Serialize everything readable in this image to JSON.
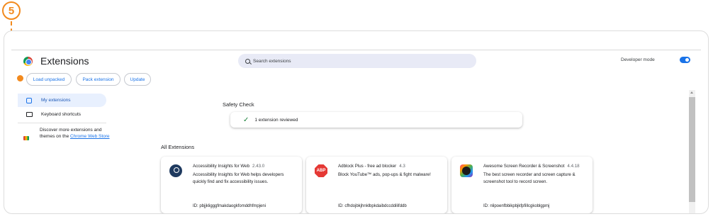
{
  "step_badge": "5",
  "header": {
    "title": "Extensions",
    "search_placeholder": "Search extensions",
    "developer_mode_label": "Developer mode",
    "developer_mode_on": true
  },
  "toolbar": {
    "load_unpacked": "Load unpacked",
    "pack_extension": "Pack extension",
    "update": "Update"
  },
  "sidebar": {
    "items": [
      {
        "label": "My extensions",
        "active": true
      },
      {
        "label": "Keyboard shortcuts",
        "active": false
      }
    ],
    "store_text": "Discover more extensions and themes on the",
    "store_link": "Chrome Web Store"
  },
  "safety_check": {
    "title": "Safety Check",
    "status": "1 extension reviewed"
  },
  "all_extensions": {
    "title": "All Extensions",
    "cards": [
      {
        "icon": "accessibility-insights-icon",
        "name": "Accessibility Insights for Web",
        "version": "2.43.0",
        "description": "Accessibility Insights for Web helps developers quickly find and fix accessibility issues.",
        "id": "ID: pbjjkligggfmakdaogkfomddhfmpjeni"
      },
      {
        "icon": "adblock-plus-icon",
        "icon_text": "ABP",
        "name": "Adblock Plus - free ad blocker",
        "version": "4.3",
        "description": "Block YouTube™ ads, pop-ups & fight malware!",
        "id": "ID: cfhdojbkjhnklbpkdaibdccddilifddb"
      },
      {
        "icon": "screen-recorder-icon",
        "name": "Awesome Screen Recorder & Screenshot",
        "version": "4.4.18",
        "description": "The best screen recorder and screen capture & screenshot tool to record screen.",
        "id": "ID: nlipoenfbbikpbjkfpfillcgkoblgpmj"
      }
    ]
  },
  "colors": {
    "accent": "#1a73e8",
    "annotation": "#f28a1e",
    "active_nav_bg": "#e8f0fe"
  }
}
